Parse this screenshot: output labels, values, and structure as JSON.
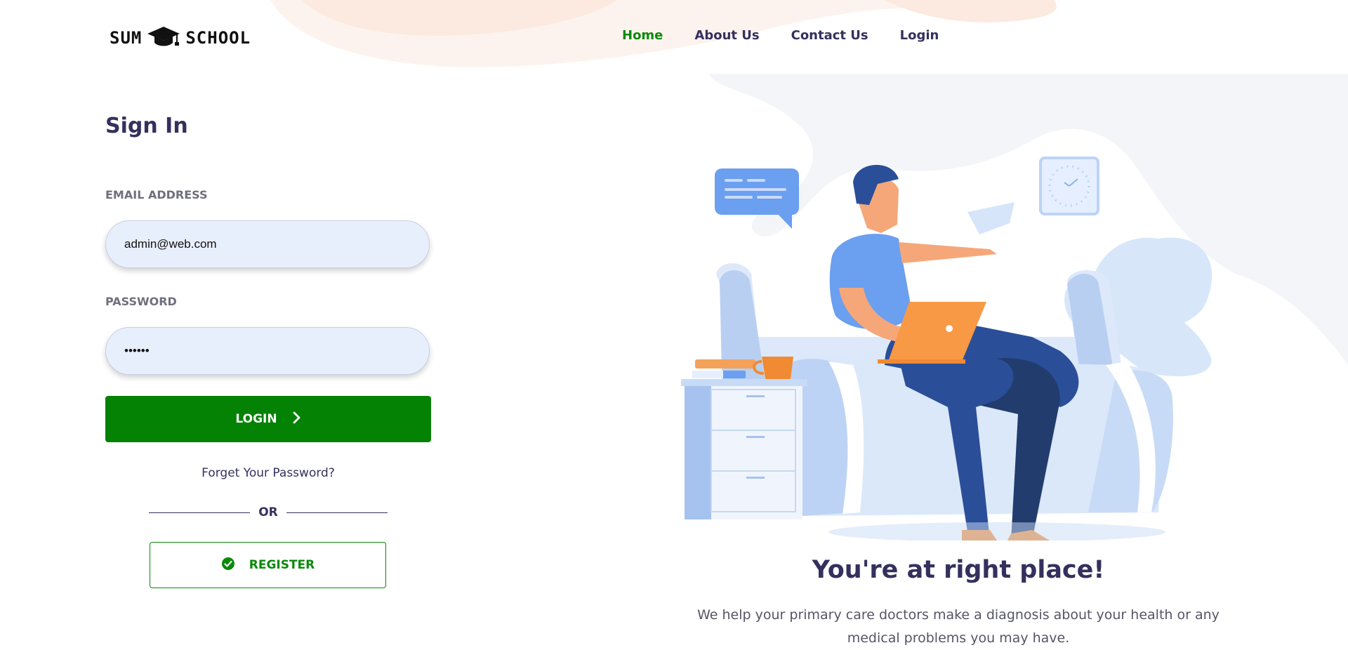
{
  "brand": {
    "left": "SUM",
    "right": "SCHOOL",
    "icon": "graduation-cap-icon"
  },
  "nav": [
    {
      "label": "Home",
      "active": true
    },
    {
      "label": "About Us",
      "active": false
    },
    {
      "label": "Contact Us",
      "active": false
    },
    {
      "label": "Login",
      "active": false
    }
  ],
  "form": {
    "title": "Sign In",
    "email_label": "EMAIL ADDRESS",
    "email_value": "admin@web.com",
    "password_label": "PASSWORD",
    "password_value": "••••••",
    "login_label": "LOGIN",
    "forgot_label": "Forget Your Password?",
    "or_label": "OR",
    "register_label": "REGISTER"
  },
  "promo": {
    "heading": "You're at right place!",
    "text": "We help your primary care doctors make a diagnosis about your health or any medical problems you may have."
  },
  "colors": {
    "primary": "#048204",
    "heading": "#34305e",
    "input_bg": "#e8effc"
  }
}
